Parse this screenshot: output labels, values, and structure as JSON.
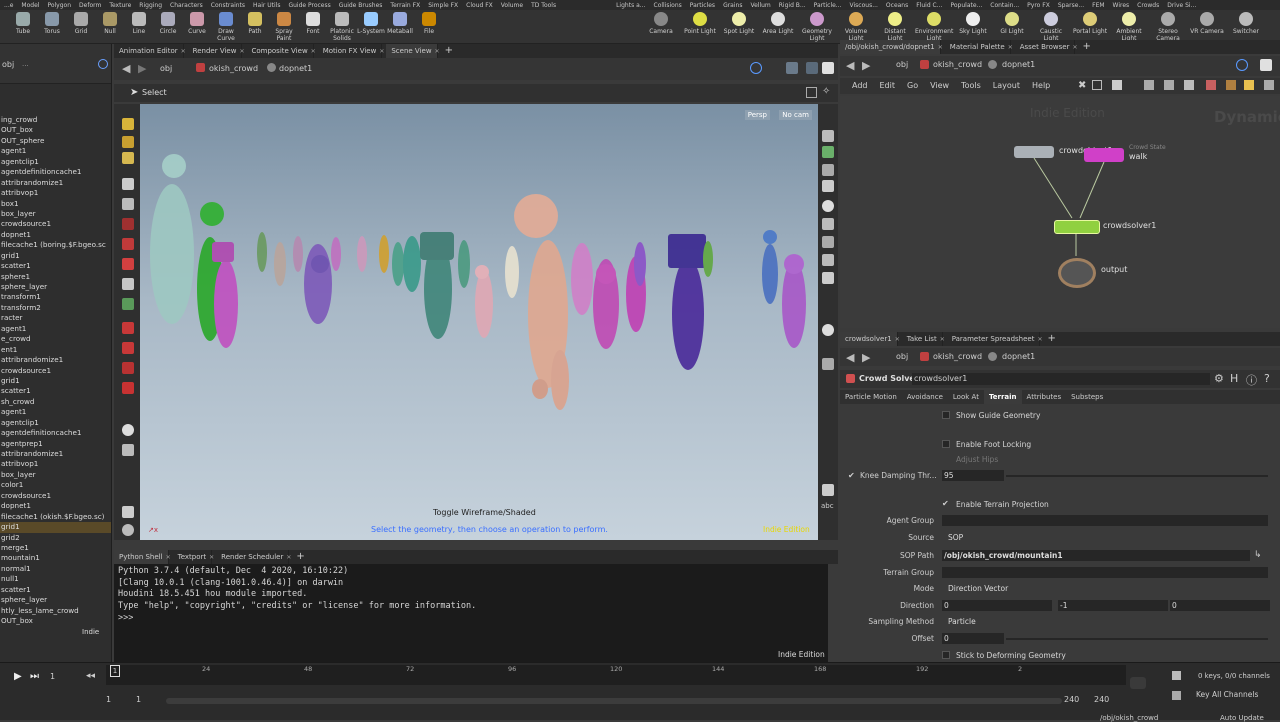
{
  "shelf": {
    "tabs_left": [
      "...e",
      "Model",
      "Polygon",
      "Deform",
      "Texture",
      "Rigging",
      "Characters",
      "Constraints",
      "Hair Utils",
      "Guide Process",
      "Guide Brushes",
      "Terrain FX",
      "Simple FX",
      "Cloud FX",
      "Volume",
      "TD Tools"
    ],
    "tabs_right": [
      "Lights a...",
      "Collisions",
      "Particles",
      "Grains",
      "Vellum",
      "Rigid B...",
      "Particle...",
      "Viscous...",
      "Oceans",
      "Fluid C...",
      "Populate...",
      "Contain...",
      "Pyro FX",
      "Sparse...",
      "FEM",
      "Wires",
      "Crowds",
      "Drive Si..."
    ],
    "tools_left": [
      "Tube",
      "Torus",
      "Grid",
      "Null",
      "Line",
      "Circle",
      "Curve",
      "Draw Curve",
      "Path",
      "Spray Paint",
      "Font",
      "Platonic Solids",
      "L-System",
      "Metaball",
      "File"
    ],
    "tools_right": [
      "Camera",
      "Point Light",
      "Spot Light",
      "Area Light",
      "Geometry Light",
      "Volume Light",
      "Distant Light",
      "Environment Light",
      "Sky Light",
      "GI Light",
      "Caustic Light",
      "Portal Light",
      "Ambient Light",
      "Stereo Camera",
      "VR Camera",
      "Switcher"
    ]
  },
  "left_panel": {
    "context": "obj",
    "path_suffix": "...",
    "items": [
      "ing_crowd",
      "OUT_box",
      "OUT_sphere",
      "agent1",
      "agentclip1",
      "agentdefinitioncache1",
      "attribrandomize1",
      "attribvop1",
      "box1",
      "box_layer",
      "crowdsource1",
      "dopnet1",
      "filecache1 (boring.$F.bgeo.sc",
      "grid1",
      "scatter1",
      "sphere1",
      "sphere_layer",
      "transform1",
      "transform2",
      "racter",
      "agent1",
      "e_crowd",
      "ent1",
      "attribrandomize1",
      "crowdsource1",
      "grid1",
      "scatter1",
      "sh_crowd",
      "agent1",
      "agentclip1",
      "agentdefinitioncache1",
      "agentprep1",
      "attribrandomize1",
      "attribvop1",
      "box_layer",
      "color1",
      "crowdsource1",
      "dopnet1",
      "filecache1 (okish.$F.bgeo.sc)",
      "grid1",
      "grid2",
      "merge1",
      "mountain1",
      "normal1",
      "null1",
      "scatter1",
      "sphere_layer",
      "htly_less_lame_crowd",
      "OUT_box"
    ],
    "selected_index": 39,
    "indie": "Indie"
  },
  "viewport": {
    "tabs": [
      "Animation Editor",
      "Render View",
      "Composite View",
      "Motion FX View",
      "Scene View"
    ],
    "active_tab": 4,
    "path": [
      "obj",
      "okish_crowd",
      "dopnet1"
    ],
    "tool": "Select",
    "persp": "Persp",
    "cam": "No cam",
    "hint": "Toggle Wireframe/Shaded",
    "status": "Select the geometry, then choose an operation to perform.",
    "indie": "Indie Edition",
    "status_color": "#3a6fff",
    "indie_color": "#e8d800"
  },
  "console": {
    "tabs": [
      "Python Shell",
      "Textport",
      "Render Scheduler"
    ],
    "lines": [
      "Python 3.7.4 (default, Dec  4 2020, 16:10:22)",
      "[Clang 10.0.1 (clang-1001.0.46.4)] on darwin",
      "Houdini 18.5.451 hou module imported.",
      "Type \"help\", \"copyright\", \"credits\" or \"license\" for more information.",
      ">>>"
    ],
    "indie": "Indie Edition"
  },
  "network": {
    "tabs": [
      "/obj/okish_crowd/dopnet1",
      "Material Palette",
      "Asset Browser"
    ],
    "path": [
      "obj",
      "okish_crowd",
      "dopnet1"
    ],
    "menu": [
      "Add",
      "Edit",
      "Go",
      "View",
      "Tools",
      "Layout",
      "Help"
    ],
    "watermark": "Indie Edition",
    "watermark2": "Dynamic",
    "nodes": {
      "crowdobject": "crowdobject1",
      "walk": "walk",
      "walk_sub": "Crowd State",
      "solver": "crowdsolver1",
      "output": "output"
    }
  },
  "parameters": {
    "tabs": [
      "crowdsolver1",
      "Take List",
      "Parameter Spreadsheet"
    ],
    "path": [
      "obj",
      "okish_crowd",
      "dopnet1"
    ],
    "node_type": "Crowd Solver",
    "node_name": "crowdsolver1",
    "subtabs": [
      "Particle Motion",
      "Avoidance",
      "Look At",
      "Terrain",
      "Attributes",
      "Substeps"
    ],
    "active_subtab": 3,
    "rows": {
      "show_guide": "Show Guide Geometry",
      "foot_locking": "Enable Foot Locking",
      "adjust_hips": "Adjust Hips",
      "knee_label": "Knee Damping Thr...",
      "knee_value": "95",
      "terrain_proj": "Enable Terrain Projection",
      "agent_group": "Agent Group",
      "source_label": "Source",
      "source_value": "SOP",
      "sop_path_label": "SOP Path",
      "sop_path_value": "/obj/okish_crowd/mountain1",
      "terrain_group": "Terrain Group",
      "mode_label": "Mode",
      "mode_value": "Direction Vector",
      "direction_label": "Direction",
      "dir_x": "0",
      "dir_y": "-1",
      "dir_z": "0",
      "sampling_label": "Sampling Method",
      "sampling_value": "Particle",
      "offset_label": "Offset",
      "offset_value": "0",
      "stick": "Stick to Deforming Geometry"
    }
  },
  "timeline": {
    "frame": "1",
    "ticks": [
      "24",
      "48",
      "72",
      "96",
      "120",
      "144",
      "168",
      "192",
      "2"
    ],
    "start": "1",
    "start2": "1",
    "end": "240",
    "end2": "240",
    "keys": "0 keys, 0/0 channels",
    "key_all": "Key All Channels",
    "bottom_path": "/obj/okish_crowd",
    "auto_update": "Auto Update"
  }
}
